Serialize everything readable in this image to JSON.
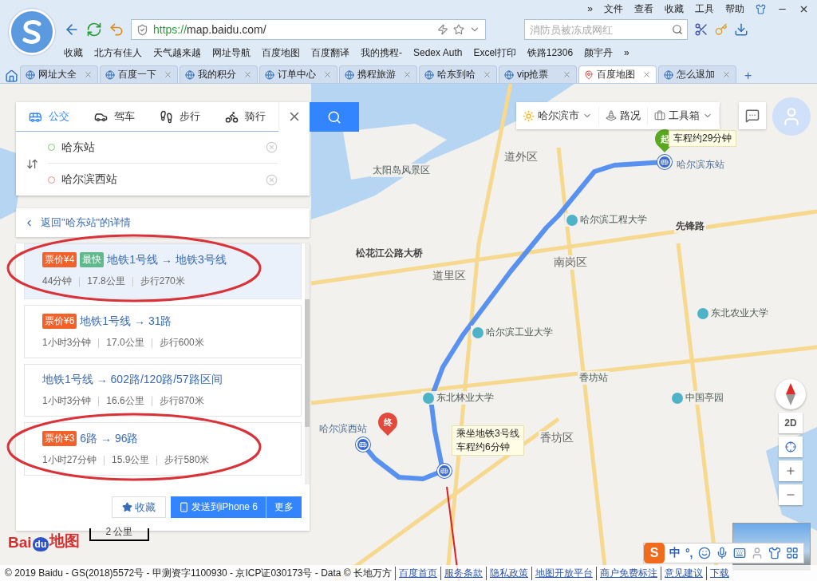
{
  "menu_bar": {
    "items": [
      "»",
      "文件",
      "查看",
      "收藏",
      "工具",
      "帮助"
    ]
  },
  "address_bar": {
    "url_scheme": "https://",
    "url_rest": "map.baidu.com/"
  },
  "search_box": {
    "placeholder": "消防员被冻成网红"
  },
  "bookmarks": [
    "收藏",
    "北方有佳人",
    "天气越来越",
    "网址导航",
    "百度地图",
    "百度翻译",
    "我的携程-",
    "Sedex Auth",
    "Excel打印",
    "铁路12306",
    "颜宇丹",
    "»"
  ],
  "tabs": [
    {
      "label": "网址大全",
      "selected": false
    },
    {
      "label": "百度一下",
      "selected": false
    },
    {
      "label": "我的积分",
      "selected": false
    },
    {
      "label": "订单中心",
      "selected": false
    },
    {
      "label": "携程旅游",
      "selected": false
    },
    {
      "label": "哈东到哈",
      "selected": false
    },
    {
      "label": "vip抢票",
      "selected": false
    },
    {
      "label": "百度地图",
      "selected": true
    },
    {
      "label": "怎么退加",
      "selected": false
    }
  ],
  "new_tab": "+",
  "route_search": {
    "modes": [
      {
        "label": "公交",
        "selected": true
      },
      {
        "label": "驾车",
        "selected": false
      },
      {
        "label": "步行",
        "selected": false
      },
      {
        "label": "骑行",
        "selected": false
      }
    ],
    "origin": "哈东站",
    "destination": "哈尔滨西站"
  },
  "back_link": "返回\"哈东站\"的详情",
  "routes": [
    {
      "price": "票价¥4",
      "tag": "最快",
      "title": "地铁1号线 → 地铁3号线",
      "duration": "44分钟",
      "distance": "17.8公里",
      "walk": "步行270米",
      "selected": true,
      "circled": true
    },
    {
      "price": "票价¥6",
      "title": "地铁1号线 → 31路",
      "duration": "1小时3分钟",
      "distance": "17.0公里",
      "walk": "步行600米",
      "selected": false,
      "circled": false
    },
    {
      "title": "地铁1号线 → 602路/120路/57路区间",
      "duration": "1小时3分钟",
      "distance": "16.6公里",
      "walk": "步行870米",
      "selected": false,
      "circled": false
    },
    {
      "price": "票价¥3",
      "title": "6路 → 96路",
      "duration": "1小时27分钟",
      "distance": "15.9公里",
      "walk": "步行580米",
      "selected": false,
      "circled": true
    }
  ],
  "panel_buttons": {
    "save": "收藏",
    "send": "发送到iPhone 6",
    "more": "更多"
  },
  "map_toolbar": {
    "city": "哈尔滨市",
    "traffic": "路况",
    "toolbox": "工具箱"
  },
  "map_labels": [
    {
      "text": "道外区",
      "kind": "district"
    },
    {
      "text": "太阳岛风景区",
      "kind": "place"
    },
    {
      "text": "哈尔滨东站",
      "kind": "station"
    },
    {
      "text": "哈尔滨工程大学",
      "kind": "poi"
    },
    {
      "text": "先锋路",
      "kind": "road"
    },
    {
      "text": "松花江公路大桥",
      "kind": "road"
    },
    {
      "text": "南岗区",
      "kind": "district"
    },
    {
      "text": "道里区",
      "kind": "district"
    },
    {
      "text": "东北农业大学",
      "kind": "poi"
    },
    {
      "text": "哈尔滨工业大学",
      "kind": "poi"
    },
    {
      "text": "香坊站",
      "kind": "place"
    },
    {
      "text": "东北林业大学",
      "kind": "poi"
    },
    {
      "text": "中国亭园",
      "kind": "poi"
    },
    {
      "text": "香坊区",
      "kind": "district"
    },
    {
      "text": "哈尔滨西站",
      "kind": "station"
    }
  ],
  "start_marker": "起",
  "end_marker": "终",
  "tooltips": [
    {
      "lines": [
        "车程约29分钟"
      ]
    },
    {
      "lines": [
        "乘坐地铁3号线",
        "车程约6分钟"
      ]
    }
  ],
  "map_controls": {
    "mode": "2D"
  },
  "logo": {
    "left": "Bai",
    "mid": "du",
    "right": "地图"
  },
  "scale": "2 公里",
  "ime_bar": {
    "logo": "S",
    "lang": "中",
    "punct": "°,"
  },
  "footer": {
    "legal": "© 2019 Baidu - GS(2018)5572号 - 甲测资字1100930 - 京ICP证030173号 - Data © 长地万方",
    "links": [
      "百度首页",
      "服务条款",
      "隐私政策",
      "地图开放平台",
      "商户免费标注",
      "意见建议",
      "下载"
    ]
  }
}
